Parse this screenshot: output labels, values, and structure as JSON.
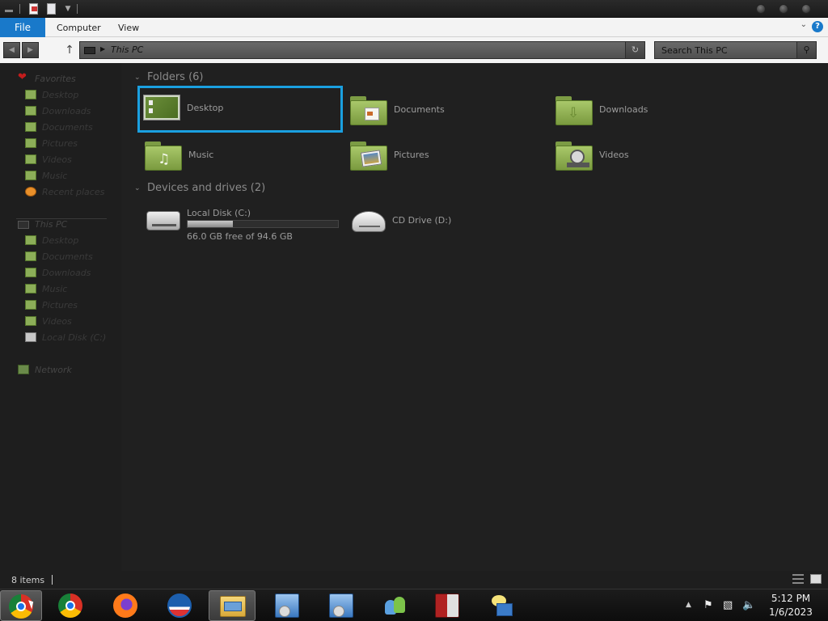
{
  "ribbon": {
    "tabs": [
      {
        "label": "File"
      },
      {
        "label": "Computer"
      },
      {
        "label": "View"
      }
    ],
    "help_icon": "question-icon"
  },
  "address_bar": {
    "path": "This PC"
  },
  "search": {
    "placeholder": "Search This PC"
  },
  "sidebar": {
    "favorites": {
      "label": "Favorites",
      "items": [
        "Desktop",
        "Downloads",
        "Documents",
        "Pictures",
        "Videos",
        "Music",
        "Recent places"
      ]
    },
    "this_pc": {
      "label": "This PC",
      "items": [
        "Desktop",
        "Documents",
        "Downloads",
        "Music",
        "Pictures",
        "Videos",
        "Local Disk (C:)"
      ]
    },
    "network": {
      "label": "Network"
    }
  },
  "content": {
    "folders_header": "Folders (6)",
    "folders": [
      {
        "name": "Desktop",
        "icon": "desktop-folder-icon",
        "selected": true
      },
      {
        "name": "Documents",
        "icon": "documents-folder-icon",
        "selected": false
      },
      {
        "name": "Downloads",
        "icon": "downloads-folder-icon",
        "selected": false
      },
      {
        "name": "Music",
        "icon": "music-folder-icon",
        "selected": false
      },
      {
        "name": "Pictures",
        "icon": "pictures-folder-icon",
        "selected": false
      },
      {
        "name": "Videos",
        "icon": "videos-folder-icon",
        "selected": false
      }
    ],
    "devices_header": "Devices and drives (2)",
    "drives": [
      {
        "name": "Local Disk (C:)",
        "free_text": "66.0 GB free of 94.6 GB",
        "used_fraction": 0.302
      },
      {
        "name": "CD Drive (D:)"
      }
    ]
  },
  "status": {
    "item_count": "8 items"
  },
  "taskbar": {
    "apps": [
      {
        "name": "chrome-icon",
        "active": true
      },
      {
        "name": "chrome-icon",
        "active": false
      },
      {
        "name": "firefox-icon",
        "active": false
      },
      {
        "name": "obama-campaign-icon",
        "active": false
      },
      {
        "name": "file-explorer-icon",
        "active": true
      },
      {
        "name": "installer-icon",
        "active": false
      },
      {
        "name": "installer-icon",
        "active": false
      },
      {
        "name": "messenger-icon",
        "active": false
      },
      {
        "name": "winrar-icon",
        "active": false
      },
      {
        "name": "remote-desktop-icon",
        "active": false
      }
    ],
    "time": "5:12 PM",
    "date": "1/6/2023"
  },
  "colors": {
    "accent": "#1979ca",
    "selection_border": "#1aa0e0",
    "folder_green": "#8cae58",
    "background": "#202020"
  }
}
